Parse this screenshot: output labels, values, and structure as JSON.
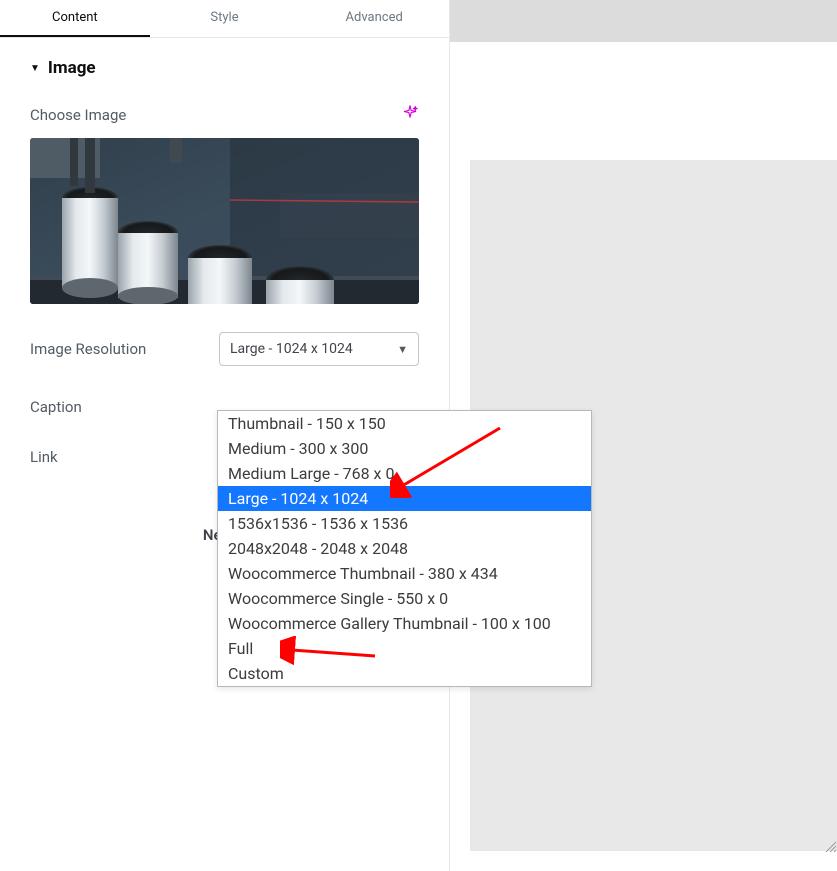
{
  "tabs": {
    "content": "Content",
    "style": "Style",
    "advanced": "Advanced"
  },
  "section": {
    "title": "Image"
  },
  "choose": {
    "label": "Choose Image"
  },
  "controls": {
    "resolution_label": "Image Resolution",
    "resolution_value": "Large - 1024 x 1024",
    "caption_label": "Caption",
    "link_label": "Link"
  },
  "dropdown": {
    "opt0": "Thumbnail - 150 x 150",
    "opt1": "Medium - 300 x 300",
    "opt2": "Medium Large - 768 x 0",
    "opt3": "Large - 1024 x 1024",
    "opt4": "1536x1536 - 1536 x 1536",
    "opt5": "2048x2048 - 2048 x 2048",
    "opt6": "Woocommerce Thumbnail - 380 x 434",
    "opt7": "Woocommerce Single - 550 x 0",
    "opt8": "Woocommerce Gallery Thumbnail - 100 x 100",
    "opt9": "Full",
    "opt10": "Custom"
  },
  "footer": {
    "need_help": "Need I"
  },
  "colors": {
    "accent": "#1477ff",
    "magenta": "#d400d4",
    "arrow": "#ff0000"
  }
}
